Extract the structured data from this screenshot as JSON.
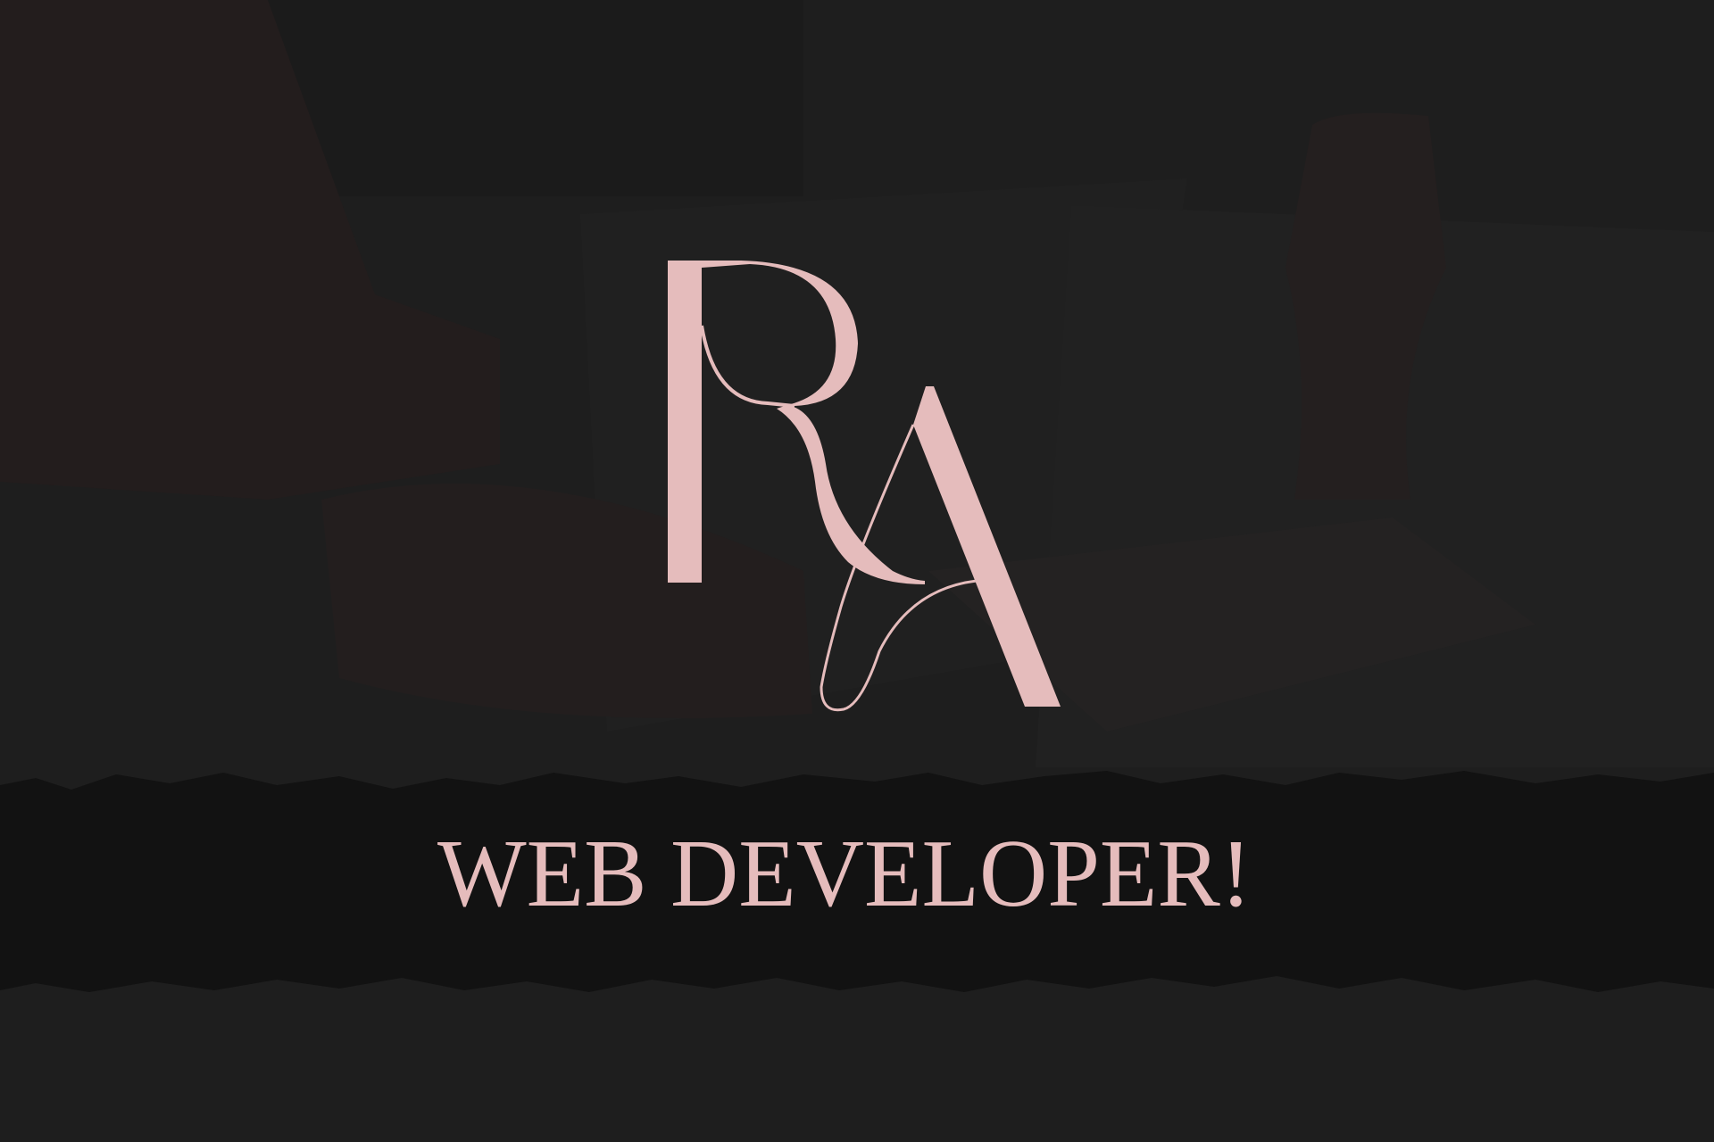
{
  "logo": {
    "monogram": "RA"
  },
  "tagline": "WEB DEVELOPER!",
  "colors": {
    "background": "#1e1e1e",
    "band": "#121212",
    "accent": "#e5bcbc"
  }
}
